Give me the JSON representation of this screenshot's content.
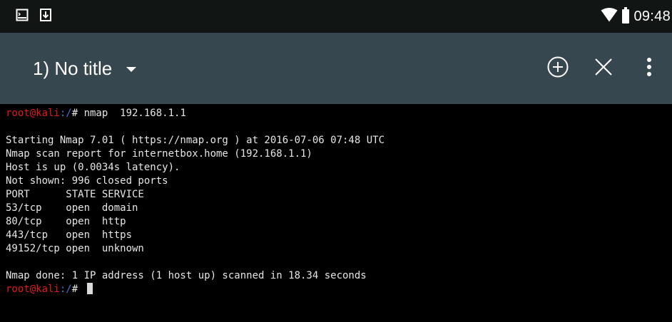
{
  "status_bar": {
    "left_icons": [
      "terminal-icon",
      "download-icon"
    ],
    "right_icons": [
      "wifi-icon",
      "battery-icon"
    ],
    "time": "09:48"
  },
  "toolbar": {
    "session_title": "1) No title",
    "actions": [
      "add-session-icon",
      "close-session-icon",
      "overflow-menu-icon"
    ]
  },
  "terminal": {
    "prompt_user": "root@kali",
    "prompt_path": ":/",
    "prompt_symbol": "# ",
    "command": "nmap  192.168.1.1",
    "output_lines": [
      "",
      "Starting Nmap 7.01 ( https://nmap.org ) at 2016-07-06 07:48 UTC",
      "Nmap scan report for internetbox.home (192.168.1.1)",
      "Host is up (0.0034s latency).",
      "Not shown: 996 closed ports",
      "PORT      STATE SERVICE",
      "53/tcp    open  domain",
      "80/tcp    open  http",
      "443/tcp   open  https",
      "49152/tcp open  unknown",
      "",
      "Nmap done: 1 IP address (1 host up) scanned in 18.34 seconds"
    ]
  },
  "colors": {
    "status_bar_bg": "#111614",
    "toolbar_bg": "#37474f",
    "terminal_bg": "#000000",
    "prompt_user": "#e01b1b",
    "prompt_path": "#4e6fd6",
    "terminal_text": "#e6e6e6"
  }
}
